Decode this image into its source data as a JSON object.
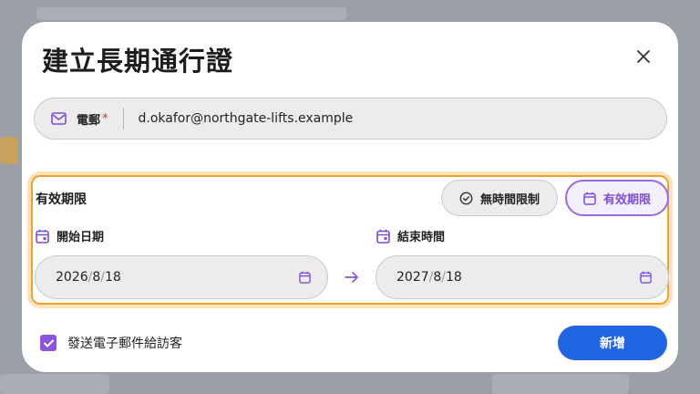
{
  "dialog": {
    "title": "建立長期通行證",
    "close_icon": "close-icon"
  },
  "email": {
    "icon": "mail-icon",
    "label": "電郵",
    "required_mark": "*",
    "value": "d.okafor@northgate-lifts.example"
  },
  "validity": {
    "title": "有效期限",
    "options": [
      {
        "label": "無時間限制",
        "icon": "check-circle-icon",
        "selected": false
      },
      {
        "label": "有效期限",
        "icon": "calendar-icon",
        "selected": true
      }
    ],
    "start": {
      "label": "開始日期",
      "icon": "calendar-icon",
      "year": "2026",
      "month": "8",
      "day": "18",
      "separator": "/"
    },
    "end": {
      "label": "結束時間",
      "icon": "calendar-icon",
      "year": "2027",
      "month": "8",
      "day": "18",
      "separator": "/"
    },
    "arrow_icon": "arrow-right-icon"
  },
  "footer": {
    "send_email_label": "發送電子郵件給訪客",
    "send_email_checked": true,
    "add_button": "新增"
  },
  "colors": {
    "accent_purple": "#8a55dc",
    "primary_blue": "#2265e3",
    "highlight_orange": "#f0a12b",
    "required_red": "#d32f2f"
  }
}
